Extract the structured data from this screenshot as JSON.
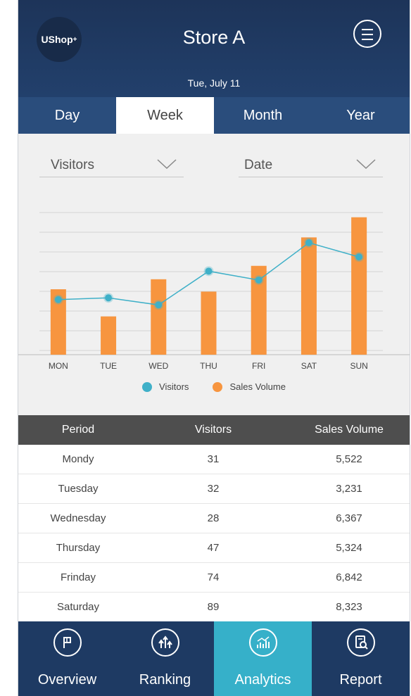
{
  "header": {
    "logo_text": "UShop",
    "logo_sup": "+",
    "title": "Store A",
    "date": "Tue, July 11"
  },
  "tabs": [
    {
      "label": "Day",
      "active": false
    },
    {
      "label": "Week",
      "active": true
    },
    {
      "label": "Month",
      "active": false
    },
    {
      "label": "Year",
      "active": false
    }
  ],
  "filters": {
    "metric": "Visitors",
    "sort": "Date"
  },
  "chart_data": {
    "type": "bar",
    "categories": [
      "MON",
      "TUE",
      "WED",
      "THU",
      "FRI",
      "SAT",
      "SUN"
    ],
    "series": [
      {
        "name": "Visitors",
        "type": "line",
        "color": "#3fb0c8",
        "values": [
          31,
          32,
          28,
          47,
          42,
          63,
          55
        ]
      },
      {
        "name": "Sales Volume",
        "type": "bar",
        "color": "#f7953f",
        "values": [
          5522,
          3231,
          6367,
          5324,
          7500,
          9900,
          11600
        ]
      }
    ],
    "legend": [
      "Visitors",
      "Sales Volume"
    ],
    "legend_position": "bottom",
    "grid": true
  },
  "table": {
    "headers": [
      "Period",
      "Visitors",
      "Sales Volume"
    ],
    "rows": [
      [
        "Mondy",
        "31",
        "5,522"
      ],
      [
        "Tuesday",
        "32",
        "3,231"
      ],
      [
        "Wednesday",
        "28",
        "6,367"
      ],
      [
        "Thursday",
        "47",
        "5,324"
      ],
      [
        "Frinday",
        "74",
        "6,842"
      ],
      [
        "Saturday",
        "89",
        "8,323"
      ]
    ]
  },
  "nav": [
    {
      "label": "Overview",
      "icon": "flag-icon",
      "active": false
    },
    {
      "label": "Ranking",
      "icon": "ranking-arrows-icon",
      "active": false
    },
    {
      "label": "Analytics",
      "icon": "analytics-chart-icon",
      "active": true
    },
    {
      "label": "Report",
      "icon": "report-search-icon",
      "active": false
    }
  ],
  "colors": {
    "header": "#1d3459",
    "tab_bar": "#2a4d7c",
    "accent": "#36b0c9",
    "bar": "#f7953f",
    "line": "#3fb0c8"
  }
}
